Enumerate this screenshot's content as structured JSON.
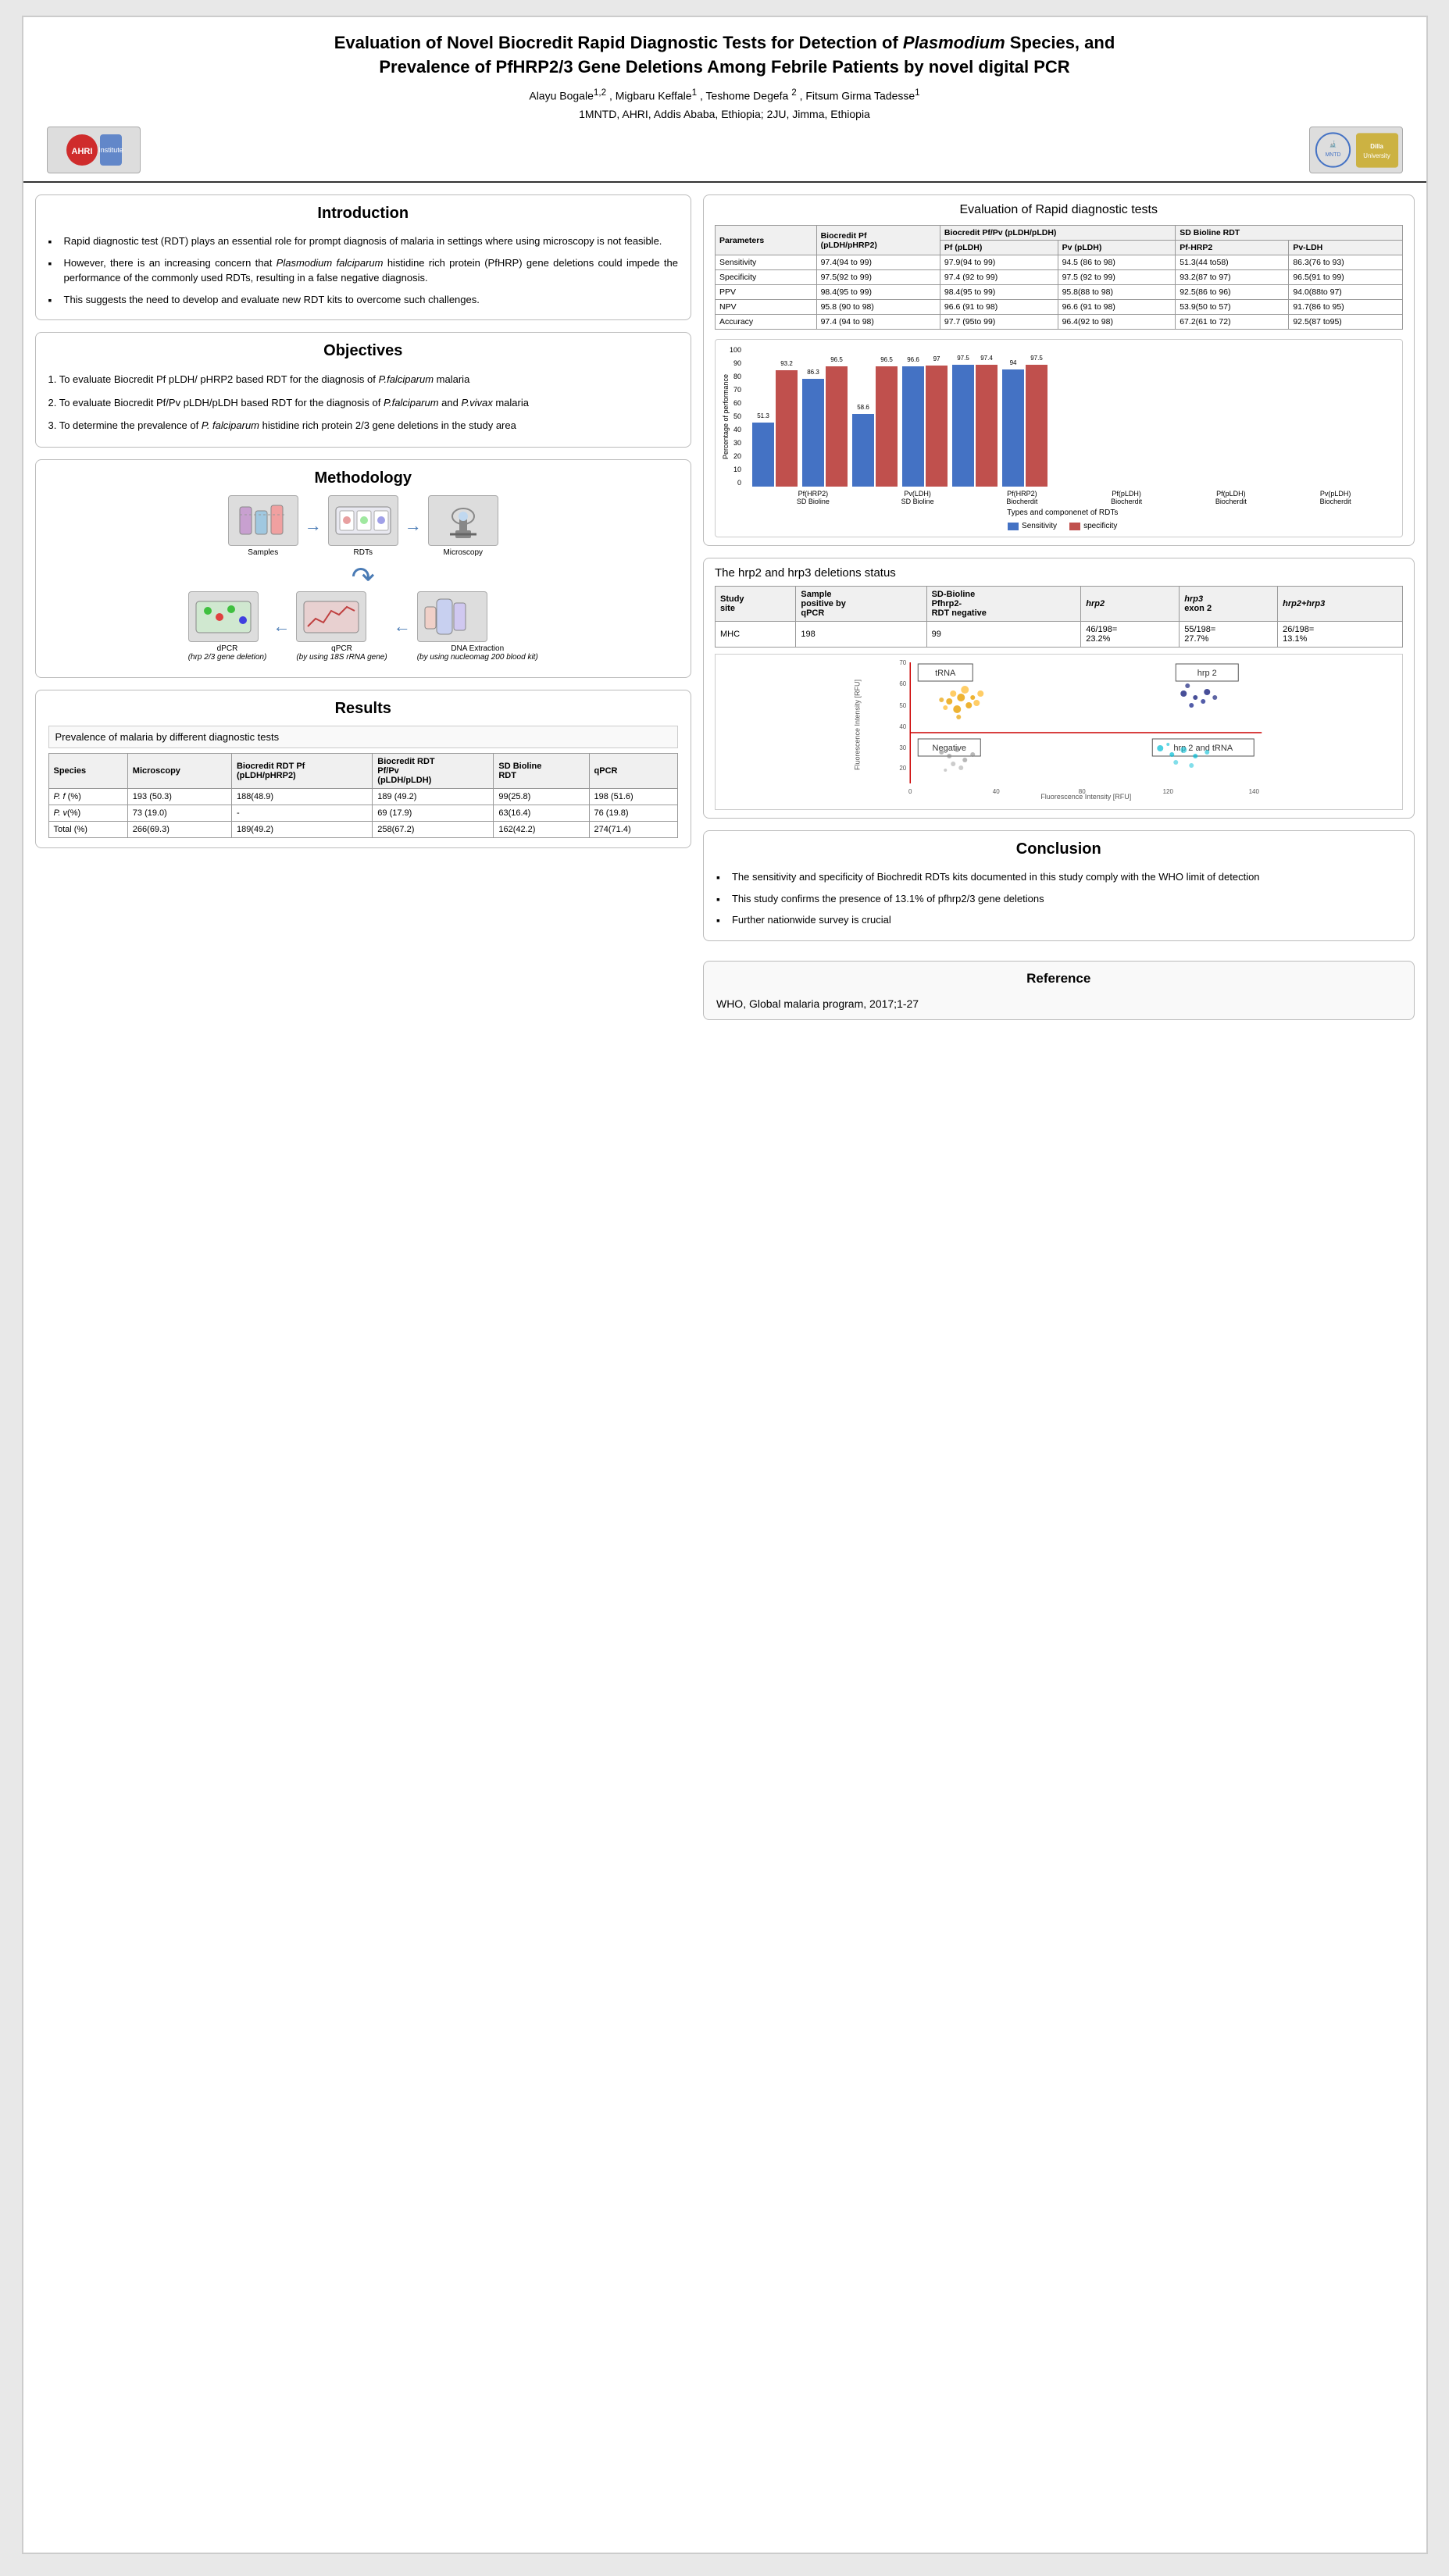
{
  "header": {
    "title_part1": "Evaluation of Novel Biocredit Rapid Diagnostic Tests for Detection of ",
    "title_italic": "Plasmodium",
    "title_part2": " Species, and",
    "title_line2": "Prevalence of PfHRP2/3 Gene Deletions Among Febrile Patients by novel digital PCR",
    "authors": "Alayu Bogale",
    "author_sup1": "1,2",
    "author_sep1": " , Migbaru Keffale",
    "author_sup2": "1",
    "author_sep2": ", Teshome Degefa ",
    "author_sup3": "2",
    "author_sep3": ", Fitsum Girma Tadesse",
    "author_sup4": "1",
    "author_sep4": " ",
    "author_inst": "1MNTD, AHRI, Addis Ababa, Ethiopia; 2JU, Jimma, Ethiopia"
  },
  "introduction": {
    "title": "Introduction",
    "bullets": [
      "Rapid diagnostic test (RDT) plays an essential role for prompt diagnosis of malaria in settings where using microscopy is not feasible.",
      "However, there is an increasing concern that Plasmodium falciparum histidine rich protein (PfHRP) gene deletions could impede the performance of the commonly used RDTs, resulting in a false negative diagnosis.",
      "This suggests the need to develop and evaluate new RDT kits to overcome such challenges."
    ]
  },
  "objectives": {
    "title": "Objectives",
    "items": [
      "1. To evaluate Biocredit Pf pLDH/ pHRP2 based RDT  for the diagnosis of P.falciparum malaria",
      "2. To evaluate Biocredit Pf/Pv pLDH/pLDH based RDT for the diagnosis of P.falciparum and P.vivax  malaria",
      "3. To determine the prevalence of P. falciparum histidine  rich protein 2/3 gene deletions in the study area"
    ]
  },
  "methodology": {
    "title": "Methodology",
    "flow_top": [
      "Samples",
      "RDTs",
      "Microscopy"
    ],
    "flow_bottom": [
      "dPCR\n(hrp 2/3 gene deletion)",
      "qPCR\n(by using 18S rRNA gene)",
      "DNA Extraction\n(by using nucleomag 200 blood kit)"
    ]
  },
  "results": {
    "title": "Results",
    "prevalence_title": "Prevalence of malaria by different diagnostic tests",
    "table_headers": [
      "Species",
      "Microscopy",
      "Biocredit RDT Pf\n(pLDH/pHRP2)",
      "Biocredit RDT\nPf/Pv\n(pLDH/pLDH)",
      "SD Bioline\nRDT",
      "qPCR"
    ],
    "table_rows": [
      [
        "P. f (%)",
        "193 (50.3)",
        "188(48.9)",
        "189 (49.2)",
        "99(25.8)",
        "198 (51.6)"
      ],
      [
        "P. v(%)",
        "73 (19.0)",
        "-",
        "69 (17.9)",
        "63(16.4)",
        "76 (19.8)"
      ],
      [
        "Total (%)",
        "266(69.3)",
        "189(49.2)",
        "258(67.2)",
        "162(42.2)",
        "274(71.4)"
      ]
    ]
  },
  "rdt_evaluation": {
    "title": "Evaluation of Rapid diagnostic tests",
    "col_headers": [
      "Parameters",
      "Biocredit Pf\n(pLDH/pHRP2)",
      "Biocredit Pf/Pv (pLDH/pLDH)",
      "SD Bioline RDT"
    ],
    "sub_headers": [
      "",
      "",
      "Pf (pLDH)",
      "Pv (pLDH)",
      "Pf-HRP2",
      "Pv-LDH"
    ],
    "rows": [
      [
        "Sensitivity",
        "97.4(94 to 99)",
        "97.9(94 to 99)",
        "94.5 (86 to 98)",
        "51.3(44 to58)",
        "86.3(76 to 93)"
      ],
      [
        "Specificity",
        "97.5(92 to 99)",
        "97.4 (92 to 99)",
        "97.5 (92 to 99)",
        "93.2(87 to 97)",
        "96.5(91 to 99)"
      ],
      [
        "PPV",
        "98.4(95 to 99)",
        "98.4(95 to 99)",
        "95.8(88 to 98)",
        "92.5(86 to 96)",
        "94.0(88to 97)"
      ],
      [
        "NPV",
        "95.8 (90 to 98)",
        "96.6 (91 to 98)",
        "96.6 (91 to 98)",
        "53.9(50 to 57)",
        "91.7(86 to 95)"
      ],
      [
        "Accuracy",
        "97.4 (94 to 98)",
        "97.7 (95to 99)",
        "96.4(92 to 98)",
        "67.2(61 to 72)",
        "92.5(87 to95)"
      ]
    ],
    "chart": {
      "title": "Types and componenet of RDTs",
      "yaxis_label": "Percentage of performance",
      "groups": [
        {
          "label": "Pf(HRP2)\nSD Bioline",
          "sensitivity": 51.3,
          "specificity": 93.2
        },
        {
          "label": "Pv(LDH)\nSD Bioline",
          "sensitivity": 86.3,
          "specificity": 96.5
        },
        {
          "label": "Pf(HRP2)\nBiocherdit",
          "sensitivity": 58.6,
          "specificity": 96.5
        },
        {
          "label": "Pf(pLDH)\nBiocherdit",
          "sensitivity": 96.6,
          "specificity": 97.0
        },
        {
          "label": "Pf(pLDH)\nBiocherdit",
          "sensitivity": 97.5,
          "specificity": 97.4
        },
        {
          "label": "Pv(pLDH)\nBiocherdit",
          "sensitivity": 94.0,
          "specificity": 97.5
        }
      ],
      "legend": [
        "Sensitivity",
        "specificity"
      ]
    }
  },
  "hrp_deletions": {
    "title": "The hrp2 and hrp3 deletions status",
    "table_headers": [
      "Study\nsite",
      "Sample\npositive by\nqPCR",
      "SD-Bioline\nPfhrp2-\nRDT negative",
      "hrp2",
      "hrp3\nexon 2",
      "hrp2+hrp3"
    ],
    "table_rows": [
      [
        "MHC",
        "198",
        "99",
        "46/198=\n23.2%",
        "55/198=\n27.7%",
        "26/198=\n13.1%"
      ]
    ],
    "scatter_labels": {
      "top_left": "tRNA",
      "top_right": "hrp 2",
      "bottom_left": "Negative",
      "bottom_right": "hrp 2 and tRNA",
      "xaxis": "Fluorescence Intensity [RFU]",
      "yaxis": "Fluorescence Intensity [RFU]"
    }
  },
  "conclusion": {
    "title": "Conclusion",
    "bullets": [
      "The sensitivity and specificity of Biochredit RDTs kits documented in this study comply with the WHO limit of detection",
      "This study confirms the presence of 13.1% of pfhrp2/3 gene deletions",
      "Further nationwide survey is crucial"
    ]
  },
  "reference": {
    "title": "Reference",
    "text": "WHO, Global malaria program, 2017;1-27"
  }
}
